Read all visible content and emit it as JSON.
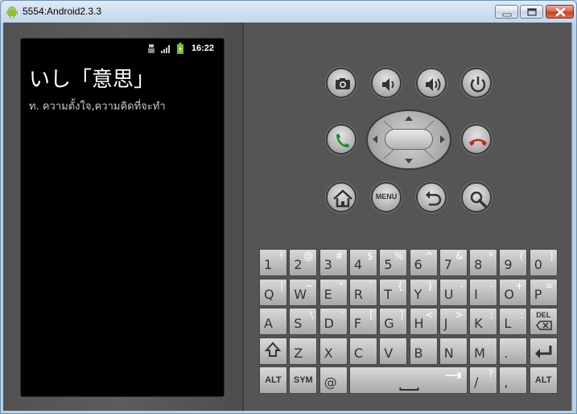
{
  "window": {
    "title": "5554:Android2.3.3",
    "minimize_icon": "minimize-icon",
    "maximize_icon": "maximize-icon",
    "close_icon": "close-icon"
  },
  "phone": {
    "status": {
      "time": "16:22",
      "icons": [
        "usb-debug-icon",
        "signal-icon",
        "battery-icon"
      ]
    },
    "word": "いし「意思」",
    "meaning": "ท. ความตั้งใจ,ความคิดที่จะทำ"
  },
  "controls": {
    "row1": [
      "camera-icon",
      "volume-down-icon",
      "volume-up-icon",
      "power-icon"
    ],
    "row2": [
      "call-icon",
      "dpad",
      "end-call-icon"
    ],
    "row3": [
      "home-icon",
      "menu-button",
      "back-icon",
      "search-icon"
    ],
    "menu_label": "MENU"
  },
  "keyboard": {
    "row1": [
      {
        "main": "1",
        "alt": "!"
      },
      {
        "main": "2",
        "alt": "@"
      },
      {
        "main": "3",
        "alt": "#"
      },
      {
        "main": "4",
        "alt": "$"
      },
      {
        "main": "5",
        "alt": "%"
      },
      {
        "main": "6",
        "alt": "^"
      },
      {
        "main": "7",
        "alt": "&"
      },
      {
        "main": "8",
        "alt": "*"
      },
      {
        "main": "9",
        "alt": "("
      },
      {
        "main": "0",
        "alt": ")"
      }
    ],
    "row2": [
      {
        "main": "Q",
        "alt": "|"
      },
      {
        "main": "W",
        "alt": "~"
      },
      {
        "main": "E",
        "alt": "\""
      },
      {
        "main": "R",
        "alt": "`"
      },
      {
        "main": "T",
        "alt": "{"
      },
      {
        "main": "Y",
        "alt": "}"
      },
      {
        "main": "U",
        "alt": "-"
      },
      {
        "main": "I",
        "alt": "-"
      },
      {
        "main": "O",
        "alt": "+"
      },
      {
        "main": "P",
        "alt": "="
      }
    ],
    "row3": [
      {
        "main": "A",
        "alt": ""
      },
      {
        "main": "S",
        "alt": "\\"
      },
      {
        "main": "D",
        "alt": "'"
      },
      {
        "main": "F",
        "alt": "["
      },
      {
        "main": "G",
        "alt": "]"
      },
      {
        "main": "H",
        "alt": "<"
      },
      {
        "main": "J",
        "alt": ">"
      },
      {
        "main": "K",
        "alt": ";"
      },
      {
        "main": "L",
        "alt": ":"
      },
      {
        "main": "DEL",
        "alt": ""
      }
    ],
    "row4": [
      {
        "main": "shift",
        "alt": ""
      },
      {
        "main": "Z",
        "alt": ""
      },
      {
        "main": "X",
        "alt": ""
      },
      {
        "main": "C",
        "alt": ""
      },
      {
        "main": "V",
        "alt": ""
      },
      {
        "main": "B",
        "alt": ""
      },
      {
        "main": "N",
        "alt": ""
      },
      {
        "main": "M",
        "alt": ""
      },
      {
        "main": ".",
        "alt": ""
      },
      {
        "main": "enter",
        "alt": ""
      }
    ],
    "row5": [
      {
        "main": "ALT",
        "alt": ""
      },
      {
        "main": "SYM",
        "alt": ""
      },
      {
        "main": "@",
        "alt": ""
      },
      {
        "main": "space",
        "alt": ""
      },
      {
        "main": "/",
        "alt": "?"
      },
      {
        "main": ",",
        "alt": ""
      },
      {
        "main": "ALT",
        "alt": ""
      }
    ]
  }
}
